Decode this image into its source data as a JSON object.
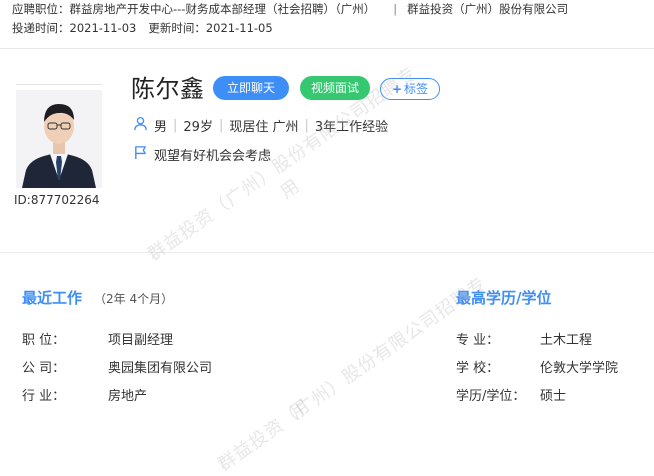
{
  "meta": {
    "position_label": "应聘职位：",
    "position_value": "群益房地产开发中心---财务成本部经理（社会招聘）（广州）",
    "separator": "|",
    "company": "群益投资（广州）股份有限公司",
    "applied_label": "投递时间：",
    "applied_value": "2021-11-03",
    "updated_label": "更新时间：",
    "updated_value": "2021-11-05"
  },
  "candidate": {
    "name": "陈尔鑫",
    "id_text": "ID:877702264",
    "gender": "男",
    "age": "29岁",
    "location": "现居住 广州",
    "experience": "3年工作经验",
    "job_status": "观望有好机会会考虑"
  },
  "actions": {
    "chat_label": "立即聊天",
    "video_label": "视频面试",
    "tag_plus": "+",
    "tag_label": "标签"
  },
  "recent_work": {
    "title": "最近工作",
    "duration": "（2年 4个月）",
    "rows": [
      {
        "label": "职    位：",
        "value": "项目副经理"
      },
      {
        "label": "公    司：",
        "value": "奥园集团有限公司"
      },
      {
        "label": "行    业：",
        "value": "房地产"
      }
    ]
  },
  "education": {
    "title": "最高学历/学位",
    "rows": [
      {
        "label": "专    业：",
        "value": "土木工程"
      },
      {
        "label": "学    校：",
        "value": "伦敦大学学院"
      },
      {
        "label": "学历/学位：",
        "value": "硕士"
      }
    ]
  },
  "watermark": {
    "line1": "群益投资（广州）股份有限公司招聘专",
    "line2": "用"
  },
  "colors": {
    "accent": "#3e8ef7",
    "video_green": "#35c870",
    "text": "#333333"
  }
}
